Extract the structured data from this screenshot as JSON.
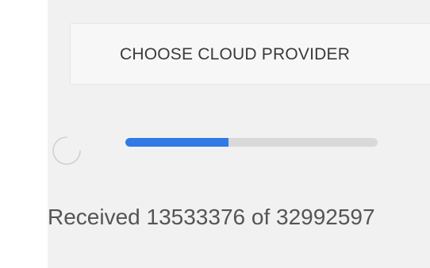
{
  "choose_button": {
    "label": "CHOOSE CLOUD PROVIDER"
  },
  "progress": {
    "received_bytes": 13533376,
    "total_bytes": 32992597,
    "fraction": 0.41,
    "accent_color": "#2f7ae5",
    "status_text": "Received 13533376 of 32992597"
  },
  "icons": {
    "spinner": "loading-spinner-icon"
  }
}
